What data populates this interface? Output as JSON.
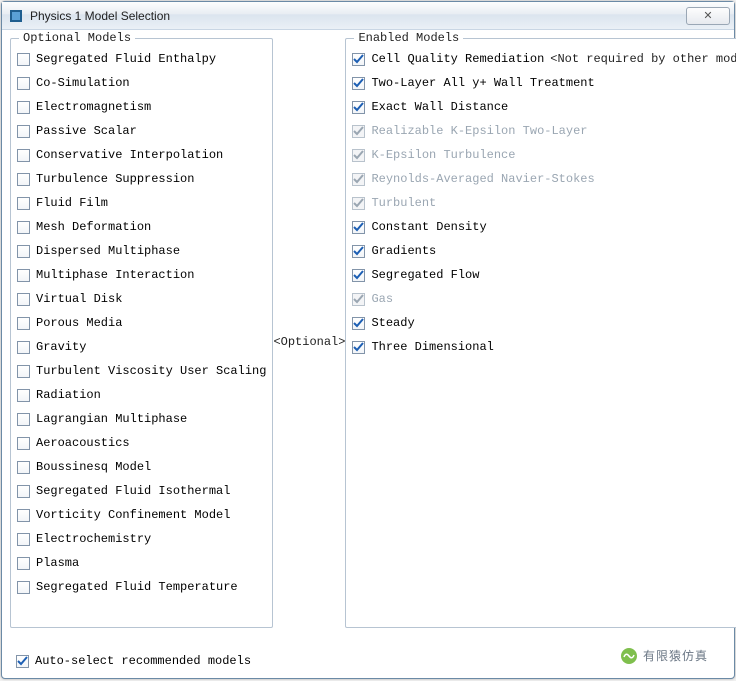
{
  "window": {
    "title": "Physics 1 Model Selection",
    "close_glyph": "✕"
  },
  "middle_label": "<Optional>",
  "optional": {
    "legend": "Optional Models",
    "items": [
      {
        "label": "Segregated Fluid Enthalpy",
        "checked": false
      },
      {
        "label": "Co-Simulation",
        "checked": false
      },
      {
        "label": "Electromagnetism",
        "checked": false
      },
      {
        "label": "Passive Scalar",
        "checked": false
      },
      {
        "label": "Conservative Interpolation",
        "checked": false
      },
      {
        "label": "Turbulence Suppression",
        "checked": false
      },
      {
        "label": "Fluid Film",
        "checked": false
      },
      {
        "label": "Mesh Deformation",
        "checked": false
      },
      {
        "label": "Dispersed Multiphase",
        "checked": false
      },
      {
        "label": "Multiphase Interaction",
        "checked": false
      },
      {
        "label": "Virtual Disk",
        "checked": false
      },
      {
        "label": "Porous Media",
        "checked": false
      },
      {
        "label": "Gravity",
        "checked": false
      },
      {
        "label": "Turbulent Viscosity User Scaling",
        "checked": false
      },
      {
        "label": "Radiation",
        "checked": false
      },
      {
        "label": "Lagrangian Multiphase",
        "checked": false
      },
      {
        "label": "Aeroacoustics",
        "checked": false
      },
      {
        "label": "Boussinesq Model",
        "checked": false
      },
      {
        "label": "Segregated Fluid Isothermal",
        "checked": false
      },
      {
        "label": "Vorticity Confinement Model",
        "checked": false
      },
      {
        "label": "Electrochemistry",
        "checked": false
      },
      {
        "label": "Plasma",
        "checked": false
      },
      {
        "label": "Segregated Fluid Temperature",
        "checked": false
      }
    ]
  },
  "enabled": {
    "legend": "Enabled Models",
    "note": "<Not required by other models>",
    "items": [
      {
        "label": "Cell Quality Remediation",
        "checked": true,
        "disabled": false,
        "has_note": true
      },
      {
        "label": "Two-Layer All y+ Wall Treatment",
        "checked": true,
        "disabled": false
      },
      {
        "label": "Exact Wall Distance",
        "checked": true,
        "disabled": false
      },
      {
        "label": "Realizable K-Epsilon Two-Layer",
        "checked": true,
        "disabled": true
      },
      {
        "label": "K-Epsilon Turbulence",
        "checked": true,
        "disabled": true
      },
      {
        "label": "Reynolds-Averaged Navier-Stokes",
        "checked": true,
        "disabled": true
      },
      {
        "label": "Turbulent",
        "checked": true,
        "disabled": true
      },
      {
        "label": "Constant Density",
        "checked": true,
        "disabled": false
      },
      {
        "label": "Gradients",
        "checked": true,
        "disabled": false
      },
      {
        "label": "Segregated Flow",
        "checked": true,
        "disabled": false
      },
      {
        "label": "Gas",
        "checked": true,
        "disabled": true
      },
      {
        "label": "Steady",
        "checked": true,
        "disabled": false
      },
      {
        "label": "Three Dimensional",
        "checked": true,
        "disabled": false
      }
    ]
  },
  "auto_select": {
    "label": "Auto-select recommended models",
    "checked": true
  },
  "watermark": {
    "text": "有限猿仿真"
  }
}
